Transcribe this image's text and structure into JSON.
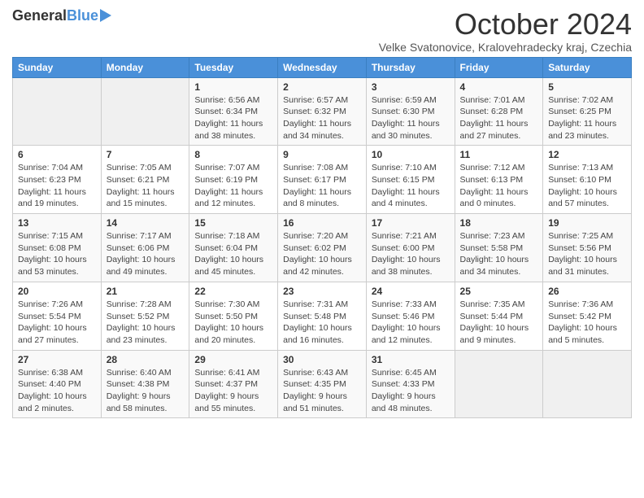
{
  "header": {
    "logo_general": "General",
    "logo_blue": "Blue",
    "month_title": "October 2024",
    "location": "Velke Svatonovice, Kralovehradecky kraj, Czechia"
  },
  "calendar": {
    "days_of_week": [
      "Sunday",
      "Monday",
      "Tuesday",
      "Wednesday",
      "Thursday",
      "Friday",
      "Saturday"
    ],
    "weeks": [
      [
        {
          "day": "",
          "info": ""
        },
        {
          "day": "",
          "info": ""
        },
        {
          "day": "1",
          "info": "Sunrise: 6:56 AM\nSunset: 6:34 PM\nDaylight: 11 hours and 38 minutes."
        },
        {
          "day": "2",
          "info": "Sunrise: 6:57 AM\nSunset: 6:32 PM\nDaylight: 11 hours and 34 minutes."
        },
        {
          "day": "3",
          "info": "Sunrise: 6:59 AM\nSunset: 6:30 PM\nDaylight: 11 hours and 30 minutes."
        },
        {
          "day": "4",
          "info": "Sunrise: 7:01 AM\nSunset: 6:28 PM\nDaylight: 11 hours and 27 minutes."
        },
        {
          "day": "5",
          "info": "Sunrise: 7:02 AM\nSunset: 6:25 PM\nDaylight: 11 hours and 23 minutes."
        }
      ],
      [
        {
          "day": "6",
          "info": "Sunrise: 7:04 AM\nSunset: 6:23 PM\nDaylight: 11 hours and 19 minutes."
        },
        {
          "day": "7",
          "info": "Sunrise: 7:05 AM\nSunset: 6:21 PM\nDaylight: 11 hours and 15 minutes."
        },
        {
          "day": "8",
          "info": "Sunrise: 7:07 AM\nSunset: 6:19 PM\nDaylight: 11 hours and 12 minutes."
        },
        {
          "day": "9",
          "info": "Sunrise: 7:08 AM\nSunset: 6:17 PM\nDaylight: 11 hours and 8 minutes."
        },
        {
          "day": "10",
          "info": "Sunrise: 7:10 AM\nSunset: 6:15 PM\nDaylight: 11 hours and 4 minutes."
        },
        {
          "day": "11",
          "info": "Sunrise: 7:12 AM\nSunset: 6:13 PM\nDaylight: 11 hours and 0 minutes."
        },
        {
          "day": "12",
          "info": "Sunrise: 7:13 AM\nSunset: 6:10 PM\nDaylight: 10 hours and 57 minutes."
        }
      ],
      [
        {
          "day": "13",
          "info": "Sunrise: 7:15 AM\nSunset: 6:08 PM\nDaylight: 10 hours and 53 minutes."
        },
        {
          "day": "14",
          "info": "Sunrise: 7:17 AM\nSunset: 6:06 PM\nDaylight: 10 hours and 49 minutes."
        },
        {
          "day": "15",
          "info": "Sunrise: 7:18 AM\nSunset: 6:04 PM\nDaylight: 10 hours and 45 minutes."
        },
        {
          "day": "16",
          "info": "Sunrise: 7:20 AM\nSunset: 6:02 PM\nDaylight: 10 hours and 42 minutes."
        },
        {
          "day": "17",
          "info": "Sunrise: 7:21 AM\nSunset: 6:00 PM\nDaylight: 10 hours and 38 minutes."
        },
        {
          "day": "18",
          "info": "Sunrise: 7:23 AM\nSunset: 5:58 PM\nDaylight: 10 hours and 34 minutes."
        },
        {
          "day": "19",
          "info": "Sunrise: 7:25 AM\nSunset: 5:56 PM\nDaylight: 10 hours and 31 minutes."
        }
      ],
      [
        {
          "day": "20",
          "info": "Sunrise: 7:26 AM\nSunset: 5:54 PM\nDaylight: 10 hours and 27 minutes."
        },
        {
          "day": "21",
          "info": "Sunrise: 7:28 AM\nSunset: 5:52 PM\nDaylight: 10 hours and 23 minutes."
        },
        {
          "day": "22",
          "info": "Sunrise: 7:30 AM\nSunset: 5:50 PM\nDaylight: 10 hours and 20 minutes."
        },
        {
          "day": "23",
          "info": "Sunrise: 7:31 AM\nSunset: 5:48 PM\nDaylight: 10 hours and 16 minutes."
        },
        {
          "day": "24",
          "info": "Sunrise: 7:33 AM\nSunset: 5:46 PM\nDaylight: 10 hours and 12 minutes."
        },
        {
          "day": "25",
          "info": "Sunrise: 7:35 AM\nSunset: 5:44 PM\nDaylight: 10 hours and 9 minutes."
        },
        {
          "day": "26",
          "info": "Sunrise: 7:36 AM\nSunset: 5:42 PM\nDaylight: 10 hours and 5 minutes."
        }
      ],
      [
        {
          "day": "27",
          "info": "Sunrise: 6:38 AM\nSunset: 4:40 PM\nDaylight: 10 hours and 2 minutes."
        },
        {
          "day": "28",
          "info": "Sunrise: 6:40 AM\nSunset: 4:38 PM\nDaylight: 9 hours and 58 minutes."
        },
        {
          "day": "29",
          "info": "Sunrise: 6:41 AM\nSunset: 4:37 PM\nDaylight: 9 hours and 55 minutes."
        },
        {
          "day": "30",
          "info": "Sunrise: 6:43 AM\nSunset: 4:35 PM\nDaylight: 9 hours and 51 minutes."
        },
        {
          "day": "31",
          "info": "Sunrise: 6:45 AM\nSunset: 4:33 PM\nDaylight: 9 hours and 48 minutes."
        },
        {
          "day": "",
          "info": ""
        },
        {
          "day": "",
          "info": ""
        }
      ]
    ]
  }
}
